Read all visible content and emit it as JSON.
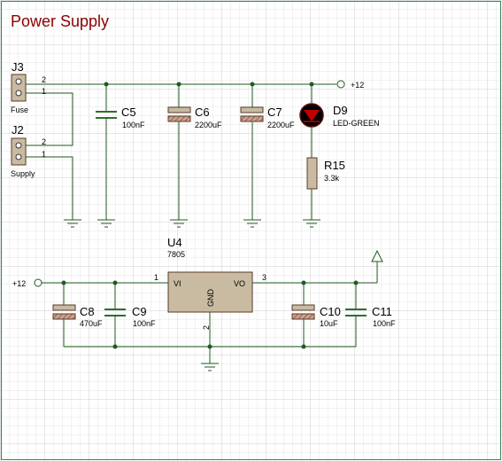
{
  "title": "Power Supply",
  "connectors": [
    {
      "ref": "J3",
      "label": "Fuse",
      "pins": [
        "2",
        "1"
      ]
    },
    {
      "ref": "J2",
      "label": "Supply",
      "pins": [
        "2",
        "1"
      ]
    }
  ],
  "components": {
    "C5": {
      "ref": "C5",
      "value": "100nF"
    },
    "C6": {
      "ref": "C6",
      "value": "2200uF"
    },
    "C7": {
      "ref": "C7",
      "value": "2200uF"
    },
    "D9": {
      "ref": "D9",
      "value": "LED-GREEN"
    },
    "R15": {
      "ref": "R15",
      "value": "3.3k"
    },
    "U4": {
      "ref": "U4",
      "value": "7805",
      "pin_vi": "VI",
      "pin_vo": "VO",
      "pin_gnd": "GND",
      "pin1": "1",
      "pin2": "2",
      "pin3": "3"
    },
    "C8": {
      "ref": "C8",
      "value": "470uF"
    },
    "C9": {
      "ref": "C9",
      "value": "100nF"
    },
    "C10": {
      "ref": "C10",
      "value": "10uF"
    },
    "C11": {
      "ref": "C11",
      "value": "100nF"
    }
  },
  "power_labels": {
    "top_right": "+12",
    "bottom_left": "+12"
  },
  "colors": {
    "title": "#8b0000",
    "wire": "#1f5a1f",
    "grid": "#d9d9d9",
    "component_fill": "#c9bba2",
    "component_stroke": "#5a3a2a"
  }
}
